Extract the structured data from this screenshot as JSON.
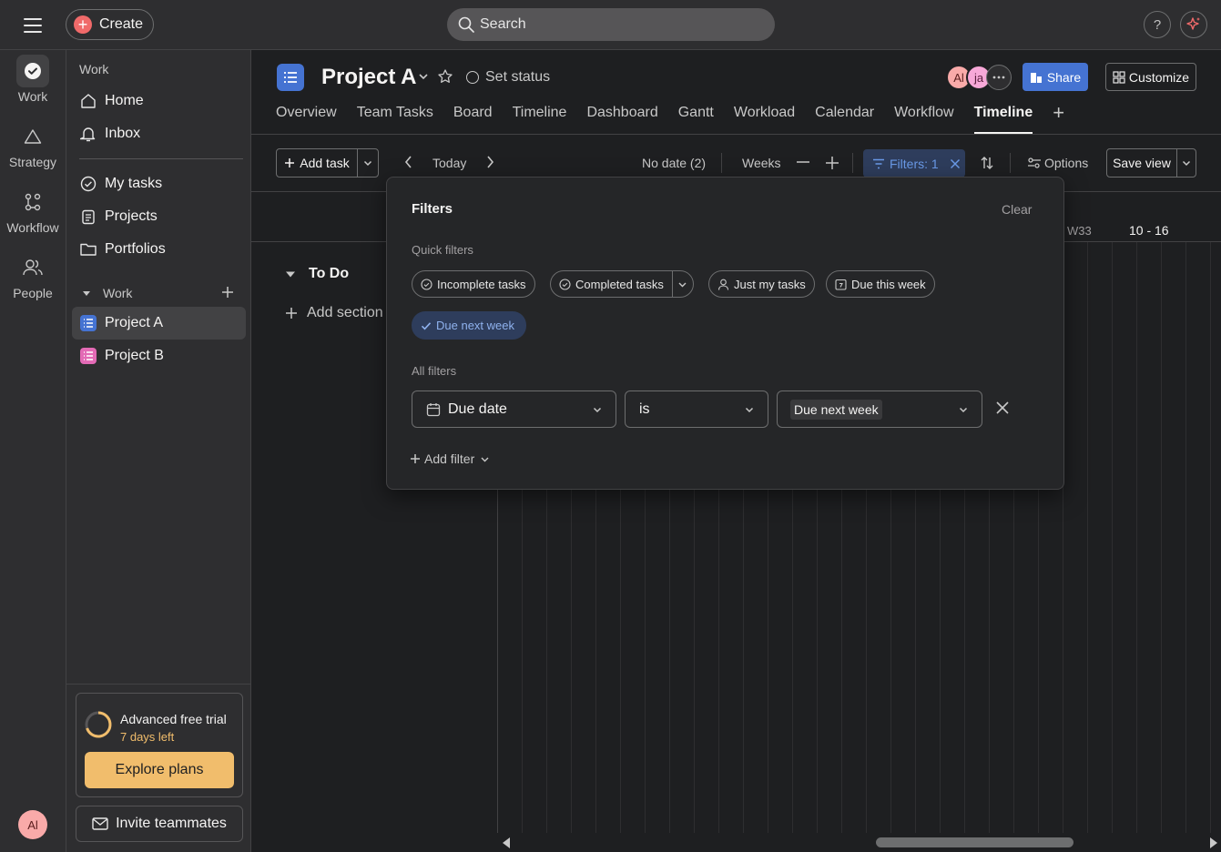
{
  "topbar": {
    "create_label": "Create",
    "search_placeholder": "Search",
    "help_label": "?"
  },
  "rail": {
    "items": [
      {
        "label": "Work",
        "icon": "check-circle-icon"
      },
      {
        "label": "Strategy",
        "icon": "triangle-icon"
      },
      {
        "label": "Workflow",
        "icon": "workflow-icon"
      },
      {
        "label": "People",
        "icon": "people-icon"
      }
    ],
    "avatar_initials": "Al"
  },
  "sidebar": {
    "heading": "Work",
    "primary": [
      {
        "label": "Home",
        "icon": "home-icon"
      },
      {
        "label": "Inbox",
        "icon": "bell-icon"
      }
    ],
    "secondary": [
      {
        "label": "My tasks",
        "icon": "check-circle-icon"
      },
      {
        "label": "Projects",
        "icon": "clipboard-icon"
      },
      {
        "label": "Portfolios",
        "icon": "folder-icon"
      }
    ],
    "work_section_label": "Work",
    "projects": [
      {
        "label": "Project A",
        "color": "#4573d2",
        "active": true
      },
      {
        "label": "Project B",
        "color": "#e36ab5",
        "active": false
      }
    ],
    "trial": {
      "title": "Advanced free trial",
      "days_left": "7 days left",
      "explore_label": "Explore plans"
    },
    "invite_label": "Invite teammates"
  },
  "project": {
    "title": "Project A",
    "set_status": "Set status",
    "members": [
      {
        "initials": "Al",
        "color": "#f9aaa9"
      },
      {
        "initials": "ja",
        "color": "#f7a8d8"
      }
    ],
    "share_label": "Share",
    "customize_label": "Customize"
  },
  "tabs": [
    "Overview",
    "Team Tasks",
    "Board",
    "Timeline",
    "Dashboard",
    "Gantt",
    "Workload",
    "Calendar",
    "Workflow",
    "Timeline"
  ],
  "active_tab_index": 9,
  "toolbar": {
    "add_task": "Add task",
    "today": "Today",
    "no_date": "No date (2)",
    "zoom": "Weeks",
    "filters": "Filters: 1",
    "options": "Options",
    "save_view": "Save view"
  },
  "timeline": {
    "week_label": "W33",
    "week_range": "10 - 16",
    "section": "To Do",
    "add_section": "Add section"
  },
  "filters_panel": {
    "title": "Filters",
    "clear": "Clear",
    "quick_filters_label": "Quick filters",
    "quick_filters": [
      "Incomplete tasks",
      "Completed tasks",
      "Just my tasks",
      "Due this week"
    ],
    "selected_quick_filter": "Due next week",
    "all_filters_label": "All filters",
    "field": "Due date",
    "operator": "is",
    "value": "Due next week",
    "add_filter": "Add filter"
  },
  "colors": {
    "accent": "#4573d2",
    "brand": "#f06a6a",
    "trial": "#f1bd6c",
    "background": "#1e1f21",
    "surface": "#2e2e30"
  }
}
